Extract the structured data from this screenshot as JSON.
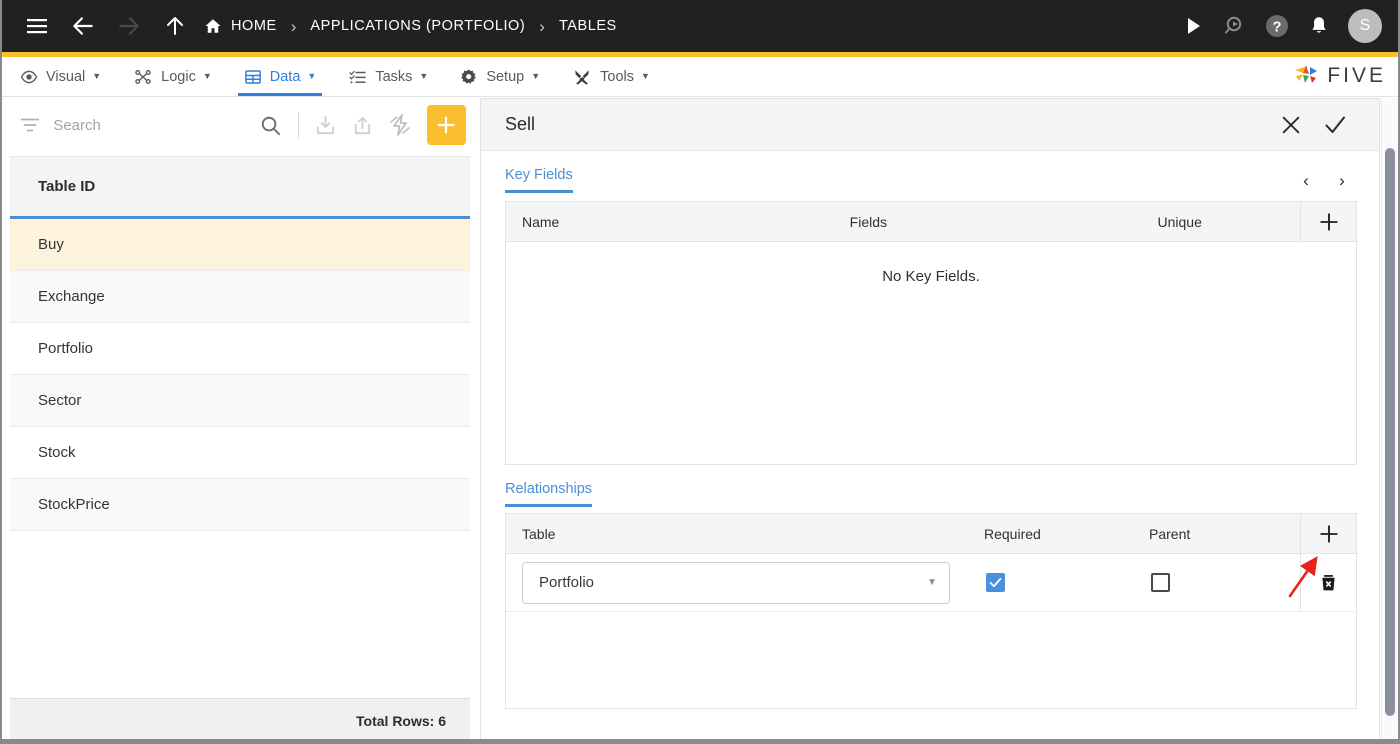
{
  "topbar": {
    "menu_icon": "hamburger-icon",
    "back_icon": "arrow-left-icon",
    "forward_icon": "arrow-right-icon",
    "up_icon": "arrow-up-icon",
    "breadcrumbs": [
      {
        "label": "HOME",
        "icon": "home-icon"
      },
      {
        "label": "APPLICATIONS (PORTFOLIO)",
        "icon": ""
      },
      {
        "label": "TABLES",
        "icon": ""
      }
    ],
    "separator": "›",
    "actions": [
      {
        "name": "run-icon"
      },
      {
        "name": "search-icon"
      },
      {
        "name": "help-icon"
      },
      {
        "name": "notifications-icon"
      }
    ],
    "avatar_initial": "S",
    "bg_color": "#212121",
    "accent_stripe": "#f9bf2e"
  },
  "menubar": {
    "items": [
      {
        "label": "Visual",
        "icon": "eye-icon",
        "caret": "▼",
        "active": false
      },
      {
        "label": "Logic",
        "icon": "logic-icon",
        "caret": "▼",
        "active": false
      },
      {
        "label": "Data",
        "icon": "table-icon",
        "caret": "▼",
        "active": true
      },
      {
        "label": "Tasks",
        "icon": "checklist-icon",
        "caret": "▼",
        "active": false
      },
      {
        "label": "Setup",
        "icon": "gear-icon",
        "caret": "▼",
        "active": false
      },
      {
        "label": "Tools",
        "icon": "tools-icon",
        "caret": "▼",
        "active": false
      }
    ],
    "active_color": "#2f7fe0",
    "brand": "FIVE"
  },
  "sidebar": {
    "search": {
      "placeholder": "Search",
      "value": "",
      "filter_icon": "filter-icon",
      "search_icon": "search-icon"
    },
    "toolbar": [
      {
        "name": "import-icon"
      },
      {
        "name": "export-icon"
      },
      {
        "name": "lightning-icon"
      }
    ],
    "add_label": "+",
    "column_header": "Table ID",
    "rows": [
      {
        "label": "Buy",
        "selected": true
      },
      {
        "label": "Exchange",
        "selected": false
      },
      {
        "label": "Portfolio",
        "selected": false
      },
      {
        "label": "Sector",
        "selected": false
      },
      {
        "label": "Stock",
        "selected": false
      },
      {
        "label": "StockPrice",
        "selected": false
      }
    ],
    "footer_total": "Total Rows: 6",
    "selected_row_color": "#fdf3dd",
    "header_underline_color": "#4a8fd4"
  },
  "detail": {
    "title": "Sell",
    "close_label": "✕",
    "confirm_label": "✓",
    "sections": [
      {
        "tab_label": "Key Fields",
        "prev_label": "‹",
        "next_label": "›",
        "columns": [
          "Name",
          "Fields",
          "Unique"
        ],
        "add_label": "+",
        "empty_text": "No Key Fields.",
        "rows": []
      },
      {
        "tab_label": "Relationships",
        "columns": [
          "Table",
          "Required",
          "Parent"
        ],
        "add_label": "+",
        "rows": [
          {
            "table": "Portfolio",
            "required": true,
            "parent": false,
            "delete_icon": "trash-icon",
            "dropdown_caret": "▼"
          }
        ]
      }
    ]
  },
  "annotation": {
    "arrow_color": "#e8231b",
    "points_to": "relationships-add-button"
  }
}
